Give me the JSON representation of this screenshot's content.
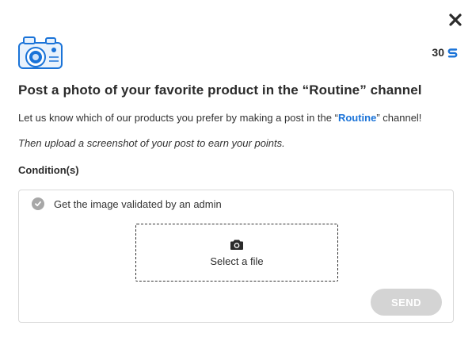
{
  "header": {
    "close_icon": "close-icon",
    "points_value": "30",
    "points_icon": "points-currency-icon",
    "accent_color": "#1a73d8"
  },
  "challenge": {
    "title": "Post a photo of your favorite product in the “Routine” channel",
    "description_before": "Let us know which of our products you prefer by making a post in the “",
    "channel_name": "Routine",
    "description_after": "” channel!",
    "hint": "Then upload a screenshot of your post to earn your points."
  },
  "conditions": {
    "heading": "Condition(s)",
    "items": [
      {
        "label": "Get the image validated by an admin",
        "icon": "check-circle-icon"
      }
    ]
  },
  "upload": {
    "icon": "camera-icon",
    "label": "Select a file"
  },
  "actions": {
    "send_label": "SEND",
    "send_disabled": true
  }
}
